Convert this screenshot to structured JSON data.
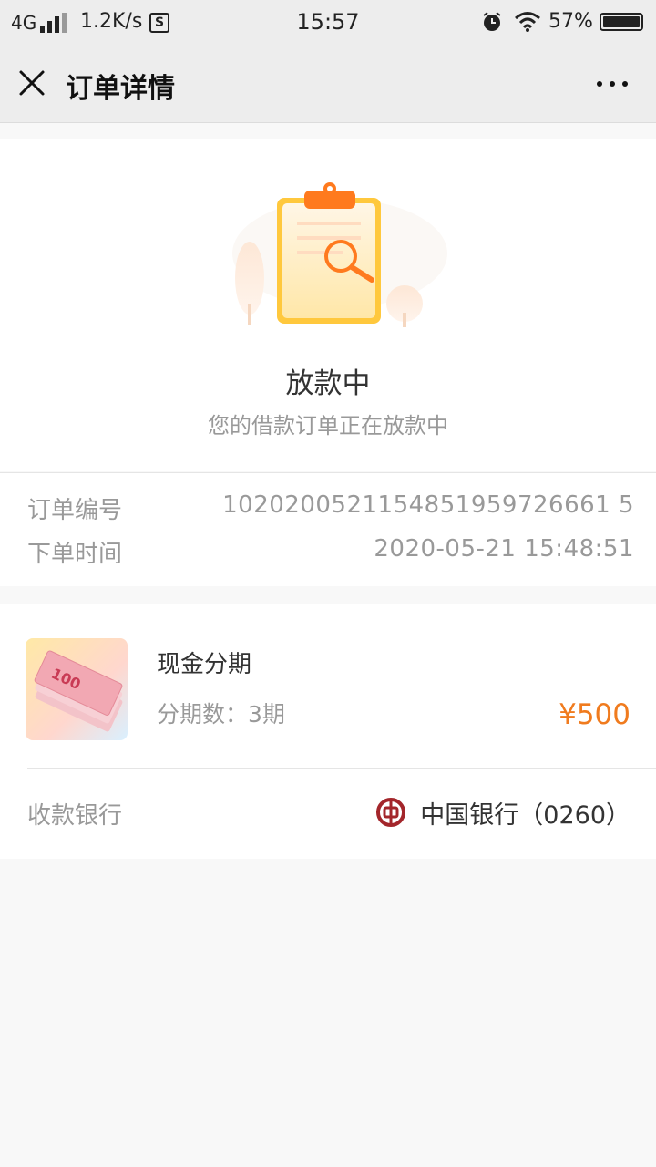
{
  "status_bar": {
    "network": "4G",
    "speed": "1.2K/s",
    "time": "15:57",
    "battery": "57%"
  },
  "navbar": {
    "title": "订单详情"
  },
  "order_status": {
    "title": "放款中",
    "description": "您的借款订单正在放款中"
  },
  "order_info": {
    "rows": [
      {
        "label": "订单编号",
        "value": "1020200521154851959726661 5"
      },
      {
        "label": "下单时间",
        "value": "2020-05-21 15:48:51"
      }
    ]
  },
  "product": {
    "name": "现金分期",
    "periods": "分期数：3期",
    "price": "¥500"
  },
  "bank": {
    "label": "收款银行",
    "name": "中国银行（0260）"
  },
  "colors": {
    "accent": "#f07b1e",
    "bank_red": "#a3262b",
    "nav_bg": "#ededed"
  }
}
